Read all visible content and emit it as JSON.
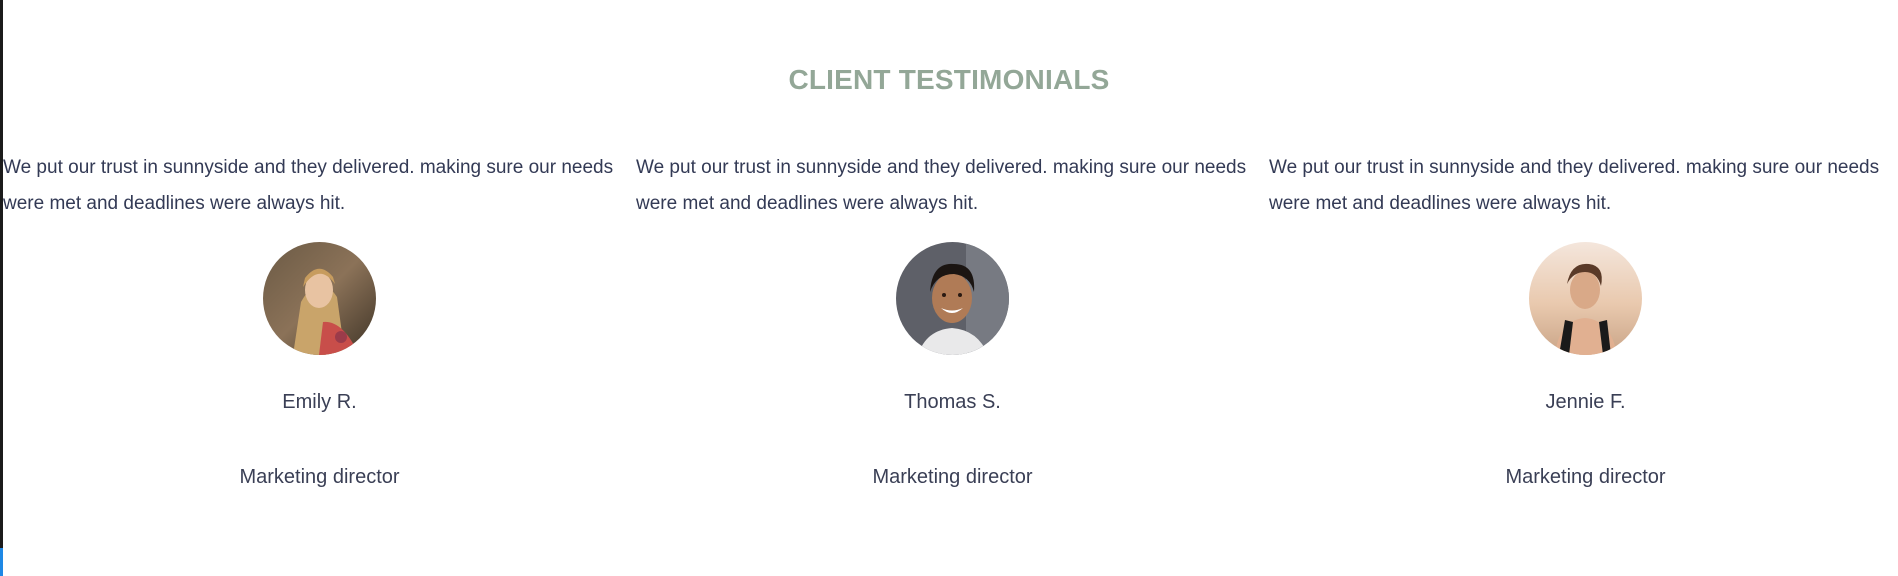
{
  "section": {
    "title": "CLIENT TESTIMONIALS",
    "title_color": "#93a797"
  },
  "testimonials": [
    {
      "quote": "We put our trust in sunnyside and they delivered. making sure our needs were met and deadlines were always hit.",
      "name": "Emily R.",
      "role": "Marketing director",
      "avatar_icon": "avatar-emily-photo"
    },
    {
      "quote": "We put our trust in sunnyside and they delivered. making sure our needs were met and deadlines were always hit.",
      "name": "Thomas S.",
      "role": "Marketing director",
      "avatar_icon": "avatar-thomas-photo"
    },
    {
      "quote": "We put our trust in sunnyside and they delivered. making sure our needs were met and deadlines were always hit.",
      "name": "Jennie F.",
      "role": "Marketing director",
      "avatar_icon": "avatar-jennie-photo"
    }
  ]
}
